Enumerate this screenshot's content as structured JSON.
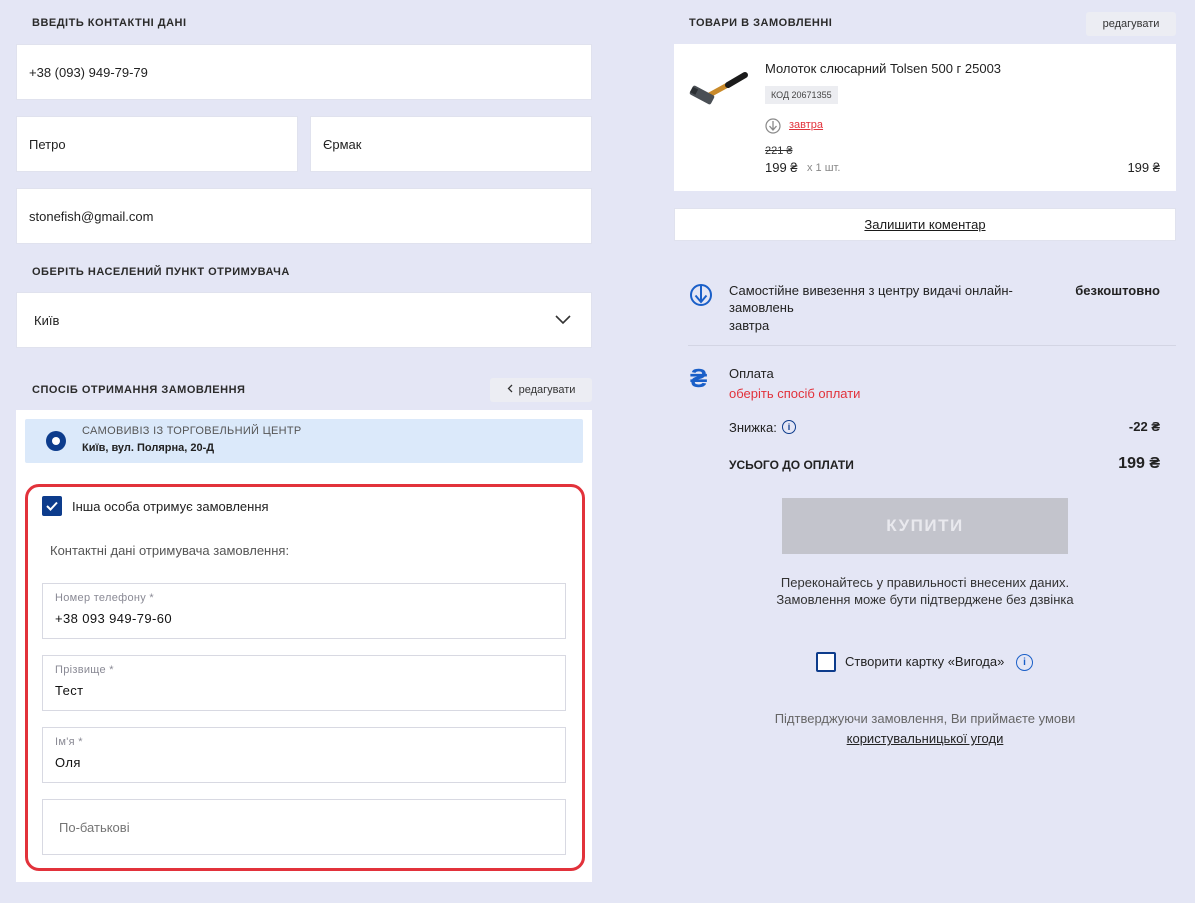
{
  "contact": {
    "title": "ВВЕДІТЬ КОНТАКТНІ ДАНІ",
    "phone": "+38 (093) 949-79-79",
    "first_name": "Петро",
    "last_name": "Єрмак",
    "email": "stonefish@gmail.com"
  },
  "city": {
    "title": "ОБЕРІТЬ НАСЕЛЕНИЙ ПУНКТ ОТРИМУВАЧА",
    "value": "Київ"
  },
  "delivery": {
    "title": "СПОСІБ ОТРИМАННЯ ЗАМОВЛЕННЯ",
    "edit_label": "редагувати",
    "option_title": "САМОВИВІЗ ІЗ ТОРГОВЕЛЬНИЙ ЦЕНТР",
    "option_address": "Київ, вул. Полярна, 20-Д"
  },
  "recipient": {
    "checkbox_label": "Інша особа отримує замовлення",
    "subtitle": "Контактні дані отримувача замовлення:",
    "phone_label": "Номер телефону *",
    "phone_value": "+38 093 949-79-60",
    "surname_label": "Прізвище *",
    "surname_value": "Тест",
    "name_label": "Ім'я *",
    "name_value": "Оля",
    "patronymic_placeholder": "По-батькові"
  },
  "order": {
    "title": "ТОВАРИ В ЗАМОВЛЕННІ",
    "edit_label": "редагувати",
    "product_name": "Молоток слюсарний Tolsen 500 г 25003",
    "product_code": "КОД 20671355",
    "delivery_when": "завтра",
    "old_price": "221 ₴",
    "price": "199 ₴",
    "qty": "x 1 шт.",
    "total": "199 ₴",
    "comment_link": "Залишити коментар"
  },
  "summary": {
    "pickup_text": "Самостійне вивезення з центру видачі онлайн-замовлень",
    "pickup_when": "завтра",
    "pickup_cost": "безкоштовно",
    "payment_label": "Оплата",
    "payment_choose": "оберіть спосіб оплати",
    "discount_label": "Знижка:",
    "discount_value": "-22 ₴",
    "total_label": "УСЬОГО ДО ОПЛАТИ",
    "total_value": "199 ₴",
    "buy_label": "КУПИТИ",
    "note_line1": "Переконайтесь у правильності внесених даних.",
    "note_line2": "Замовлення може бути підтверджене без дзвінка",
    "card_label": "Створити картку «Вигода»",
    "terms_line1": "Підтверджуючи замовлення, Ви приймаєте умови",
    "terms_link": "користувальницької угоди"
  },
  "colors": {
    "brand_blue": "#0d3c8c",
    "accent_red": "#e2323b",
    "highlight_blue": "#dbe9fa"
  }
}
